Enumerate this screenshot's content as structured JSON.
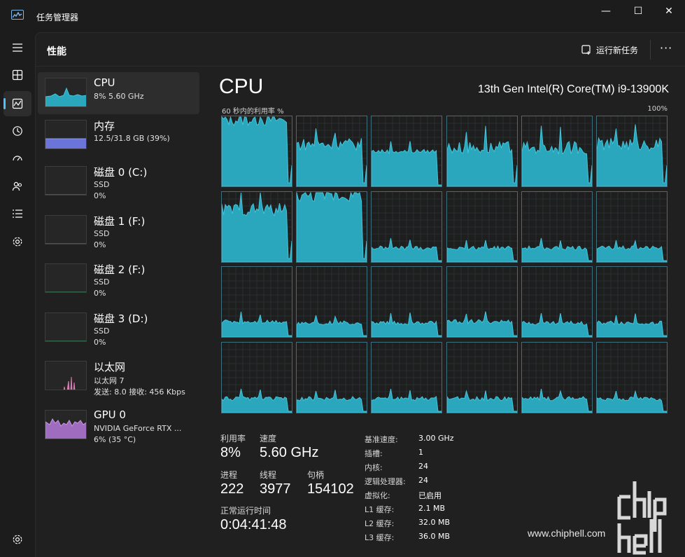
{
  "window": {
    "title": "任务管理器",
    "minimize_glyph": "—",
    "maximize_glyph": "☐",
    "close_glyph": "✕"
  },
  "nav": {
    "items": [
      {
        "icon": "hamburger-menu-icon"
      },
      {
        "icon": "processes-icon"
      },
      {
        "icon": "performance-icon",
        "active": true
      },
      {
        "icon": "app-history-icon"
      },
      {
        "icon": "startup-apps-icon"
      },
      {
        "icon": "users-icon"
      },
      {
        "icon": "details-icon"
      },
      {
        "icon": "services-icon"
      },
      {
        "icon": "settings-icon"
      }
    ]
  },
  "header": {
    "title": "性能",
    "run_new_task": "运行新任务",
    "more": "···"
  },
  "devices": [
    {
      "name": "CPU",
      "line2": "8% 5.60 GHz",
      "line3": ""
    },
    {
      "name": "内存",
      "line2": "12.5/31.8 GB (39%)",
      "line3": ""
    },
    {
      "name": "磁盘 0 (C:)",
      "line2": "SSD",
      "line3": "0%"
    },
    {
      "name": "磁盘 1 (F:)",
      "line2": "SSD",
      "line3": "0%"
    },
    {
      "name": "磁盘 2 (F:)",
      "line2": "SSD",
      "line3": "0%"
    },
    {
      "name": "磁盘 3 (D:)",
      "line2": "SSD",
      "line3": "0%"
    },
    {
      "name": "以太网",
      "line2": "以太网 7",
      "line3": "发送: 8.0  接收: 456 Kbps"
    },
    {
      "name": "GPU 0",
      "line2": "NVIDIA GeForce RTX ...",
      "line3": "6% (35 °C)"
    }
  ],
  "detail": {
    "title": "CPU",
    "model": "13th Gen Intel(R) Core(TM) i9-13900K",
    "util_label": "60 秒内的利用率 %",
    "util_max": "100%",
    "stats": {
      "utilization_label": "利用率",
      "utilization": "8%",
      "speed_label": "速度",
      "speed": "5.60 GHz",
      "processes_label": "进程",
      "processes": "222",
      "threads_label": "线程",
      "threads": "3977",
      "handles_label": "句柄",
      "handles": "154102",
      "uptime_label": "正常运行时间",
      "uptime": "0:04:41:48"
    },
    "specs": [
      {
        "k": "基准速度:",
        "v": "3.00 GHz"
      },
      {
        "k": "插槽:",
        "v": "1"
      },
      {
        "k": "内核:",
        "v": "24"
      },
      {
        "k": "逻辑处理器:",
        "v": "24"
      },
      {
        "k": "虚拟化:",
        "v": "已启用"
      },
      {
        "k": "L1 缓存:",
        "v": "2.1 MB"
      },
      {
        "k": "L2 缓存:",
        "v": "32.0 MB"
      },
      {
        "k": "L3 缓存:",
        "v": "36.0 MB"
      }
    ]
  },
  "core_levels": [
    0.95,
    0.6,
    0.5,
    0.55,
    0.55,
    0.6,
    0.75,
    0.95,
    0.2,
    0.2,
    0.2,
    0.2,
    0.22,
    0.2,
    0.2,
    0.22,
    0.2,
    0.2,
    0.2,
    0.2,
    0.2,
    0.2,
    0.2,
    0.2
  ],
  "colors": {
    "cpu_fill": "#2aa7bd",
    "cpu_line": "#43c5dc",
    "memory": "#6b74d8",
    "ethernet": "#d77fb1",
    "gpu": "#9f6cc0",
    "disk": "#3c9d6d"
  },
  "watermark": "www.chiphell.com"
}
